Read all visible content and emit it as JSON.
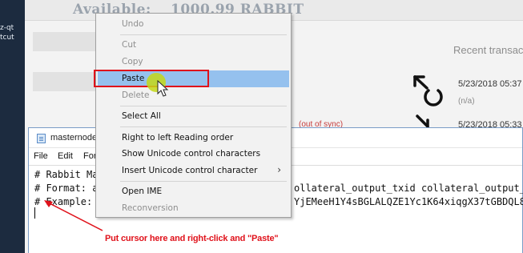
{
  "desktop": {
    "labels": [
      "z-qt",
      "tcut"
    ]
  },
  "wallet": {
    "available_label": "Available:",
    "available_amount": "1000.99 RABBIT",
    "recent_transactions_title": "Recent transac",
    "out_of_sync": "(out of sync)",
    "transactions": [
      {
        "date": "5/23/2018 05:37",
        "note": "(n/a)"
      },
      {
        "date": "5/23/2018 05:33"
      }
    ]
  },
  "notepad": {
    "title": "masternode",
    "menu": {
      "file": "File",
      "edit": "Edit",
      "format": "For"
    },
    "lines": {
      "line1_left": "# Rabbit Ma",
      "line2_left": "# Format: a",
      "line2_right": "ollateral_output_txid collateral_output_",
      "line3_left": "# Example:",
      "line3_right": "YjEMeeH1Y4sBGLALQZE1Yc1K64xiqgX37tGBDQL8"
    }
  },
  "context_menu": {
    "undo": "Undo",
    "cut": "Cut",
    "copy": "Copy",
    "paste": "Paste",
    "delete": "Delete",
    "select_all": "Select All",
    "rtl": "Right to left Reading order",
    "show_unicode": "Show Unicode control characters",
    "insert_unicode": "Insert Unicode control character",
    "insert_unicode_arrow": "›",
    "open_ime": "Open IME",
    "reconversion": "Reconversion"
  },
  "annotation": {
    "text": "Put cursor here and right-click and \"Paste\"",
    "color": "#e0121b"
  },
  "colors": {
    "highlight": "#95c1ee",
    "desktop": "#1c2b3f"
  }
}
